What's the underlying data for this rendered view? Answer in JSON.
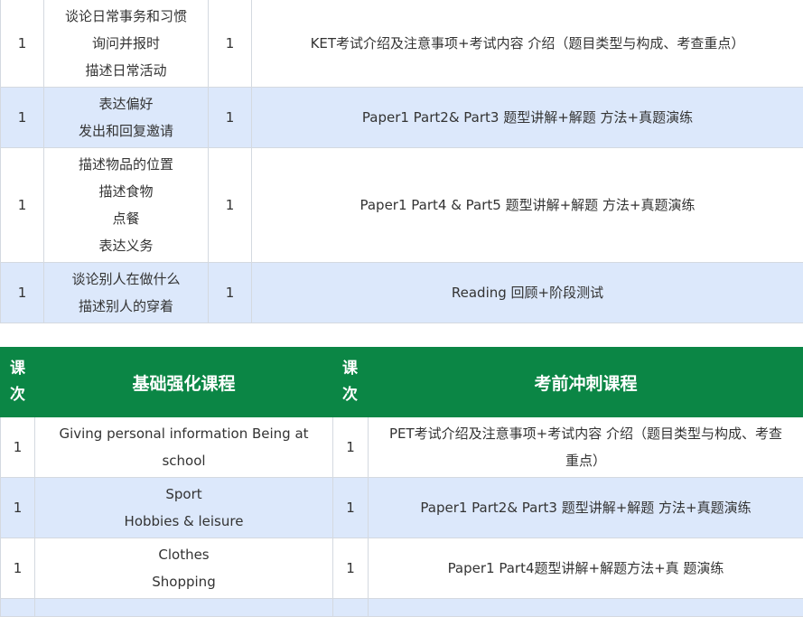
{
  "table1": {
    "rows": [
      {
        "num1": "1",
        "topics": [
          "谈论日常事务和习惯",
          "询问并报时",
          "描述日常活动"
        ],
        "num2": "1",
        "content": "KET考试介绍及注意事项+考试内容 介绍（题目类型与构成、考查重点）"
      },
      {
        "num1": "1",
        "topics": [
          "表达偏好",
          "发出和回复邀请"
        ],
        "num2": "1",
        "content": "Paper1 Part2& Part3 题型讲解+解题 方法+真题演练"
      },
      {
        "num1": "1",
        "topics": [
          "描述物品的位置",
          "描述食物",
          "点餐",
          "表达义务"
        ],
        "num2": "1",
        "content": "Paper1 Part4 & Part5 题型讲解+解题 方法+真题演练"
      },
      {
        "num1": "1",
        "topics": [
          "谈论别人在做什么",
          "描述别人的穿着"
        ],
        "num2": "1",
        "content": "Reading 回顾+阶段测试"
      }
    ]
  },
  "table2": {
    "header": {
      "num1_top": "课",
      "num1_bottom": "次",
      "title1": "基础强化课程",
      "num2_top": "课",
      "num2_bottom": "次",
      "title2": "考前冲刺课程"
    },
    "rows": [
      {
        "num1": "1",
        "topics": [
          "Giving personal information Being at",
          "school"
        ],
        "num2": "1",
        "content_lines": [
          "PET考试介绍及注意事项+考试内容 介绍（题目类型与构成、考查",
          "重点）"
        ]
      },
      {
        "num1": "1",
        "topics": [
          "Sport",
          "Hobbies & leisure"
        ],
        "num2": "1",
        "content_lines": [
          "Paper1 Part2& Part3 题型讲解+解题 方法+真题演练"
        ]
      },
      {
        "num1": "1",
        "topics": [
          "Clothes",
          "Shopping"
        ],
        "num2": "1",
        "content_lines": [
          "Paper1 Part4题型讲解+解题方法+真 题演练"
        ]
      }
    ]
  }
}
